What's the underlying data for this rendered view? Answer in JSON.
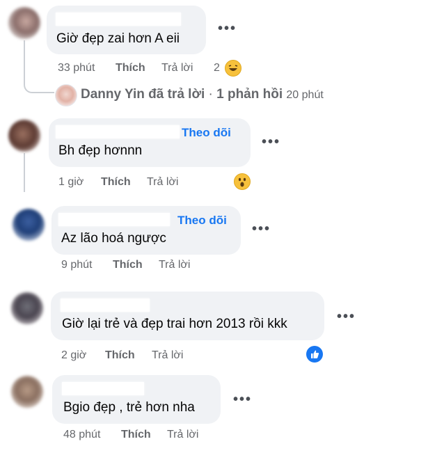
{
  "comments": [
    {
      "text": "Giờ đẹp zai hơn A eii",
      "time": "33 phút",
      "like": "Thích",
      "reply": "Trả lời",
      "reaction_count": "2",
      "reaction": "laughing-emoji"
    },
    {
      "follow": "Theo dõi",
      "text": "Bh đẹp hơnnn",
      "time": "1 giờ",
      "like": "Thích",
      "reply": "Trả lời",
      "reaction": "wow-emoji"
    },
    {
      "follow": "Theo dõi",
      "text": "Az lão hoá ngược",
      "time": "9 phút",
      "like": "Thích",
      "reply": "Trả lời"
    },
    {
      "text": "Giờ lại trẻ và đẹp trai hơn 2013 rồi kkk",
      "time": "2 giờ",
      "like": "Thích",
      "reply": "Trả lời",
      "reaction": "like-icon"
    },
    {
      "text": "Bgio đẹp , trẻ hơn nha",
      "time": "48 phút",
      "like": "Thích",
      "reply": "Trả lời"
    }
  ],
  "reply_summary": {
    "name": "Danny Yin",
    "action": "đã trả lời",
    "separator": "·",
    "count": "1 phản hồi",
    "time": "20 phút"
  },
  "more_glyph": "•••",
  "icons": {
    "more": "more-dots-icon"
  },
  "colors": {
    "link": "#1877f2",
    "bubble": "#f0f2f5",
    "meta": "#65676b"
  }
}
